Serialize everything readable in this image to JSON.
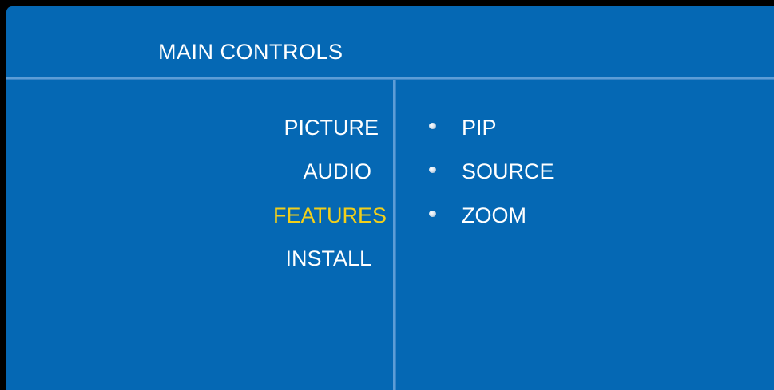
{
  "header": {
    "title": "MAIN CONTROLS"
  },
  "left_menu": {
    "items": [
      {
        "label": "PICTURE",
        "selected": false
      },
      {
        "label": "AUDIO",
        "selected": false
      },
      {
        "label": "FEATURES",
        "selected": true
      },
      {
        "label": "INSTALL",
        "selected": false
      }
    ]
  },
  "right_menu": {
    "items": [
      {
        "label": "PIP",
        "icon": "bullet-icon"
      },
      {
        "label": "SOURCE",
        "icon": "bullet-icon"
      },
      {
        "label": "ZOOM",
        "icon": "bullet-icon"
      }
    ]
  },
  "colors": {
    "panel_background": "#0568b4",
    "divider": "#5d9dd6",
    "text": "#ffffff",
    "selected_text": "#f2cf1a"
  }
}
